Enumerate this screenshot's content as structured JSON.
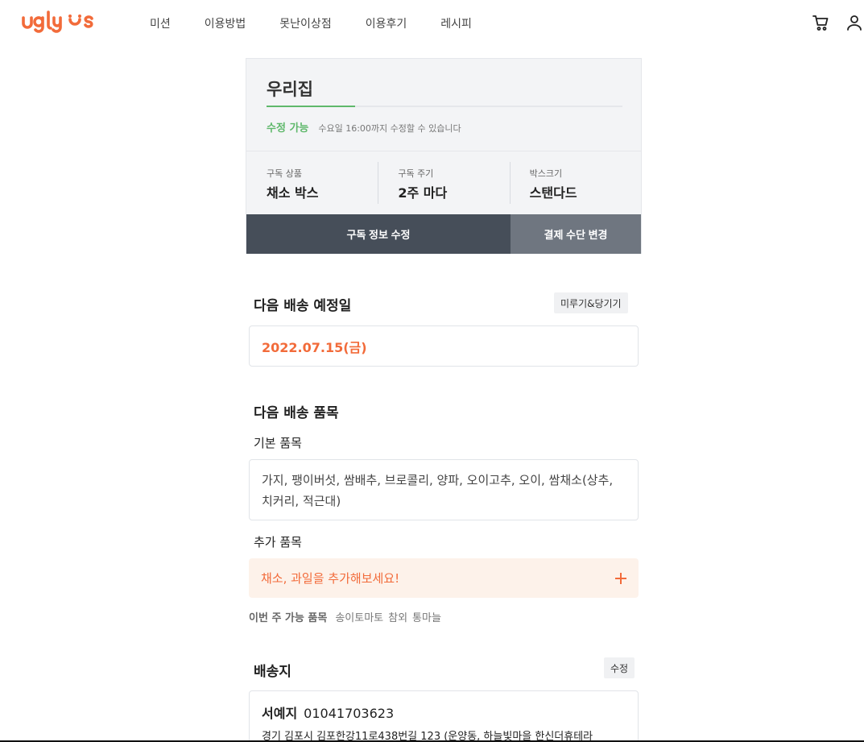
{
  "brand": {
    "logo_text": "ugly us",
    "accent_color": "#f26b3a",
    "success_color": "#5fb86b"
  },
  "nav": {
    "items": [
      {
        "label": "미션"
      },
      {
        "label": "이용방법"
      },
      {
        "label": "못난이상점"
      },
      {
        "label": "이용후기"
      },
      {
        "label": "레시피"
      }
    ]
  },
  "header_icons": [
    "cart-icon",
    "user-icon"
  ],
  "subscription": {
    "name": "우리집",
    "status": "수정 가능",
    "status_note": "수요일 16:00까지 수정할 수 있습니다",
    "info": [
      {
        "label": "구독 상품",
        "value": "채소 박스"
      },
      {
        "label": "구독 주기",
        "value": "2주 마다"
      },
      {
        "label": "박스크기",
        "value": "스탠다드"
      }
    ],
    "edit_button": "구독 정보 수정",
    "payment_button": "결제 수단 변경"
  },
  "next_delivery": {
    "title": "다음 배송 예정일",
    "reschedule_button": "미루기&당기기",
    "date": "2022.07.15(금)"
  },
  "next_items": {
    "title": "다음 배송 품목",
    "basic_label": "기본 품목",
    "basic_items": "가지, 팽이버섯, 쌈배추, 브로콜리, 양파, 오이고추, 오이, 쌈채소(상추, 치커리, 적근대)",
    "extra_label": "추가 품목",
    "extra_cta": "채소, 과일을 추가해보세요!",
    "available_label": "이번 주 가능 품목",
    "available_items": [
      "송이토마토",
      "참외",
      "통마늘"
    ]
  },
  "shipping": {
    "title": "배송지",
    "edit_button": "수정",
    "name": "서예지",
    "phone": "01041703623",
    "address": "경기 김포시 김포한강11로438번길 123 (운양동, 하늘빛마을 한신더휴테라"
  }
}
